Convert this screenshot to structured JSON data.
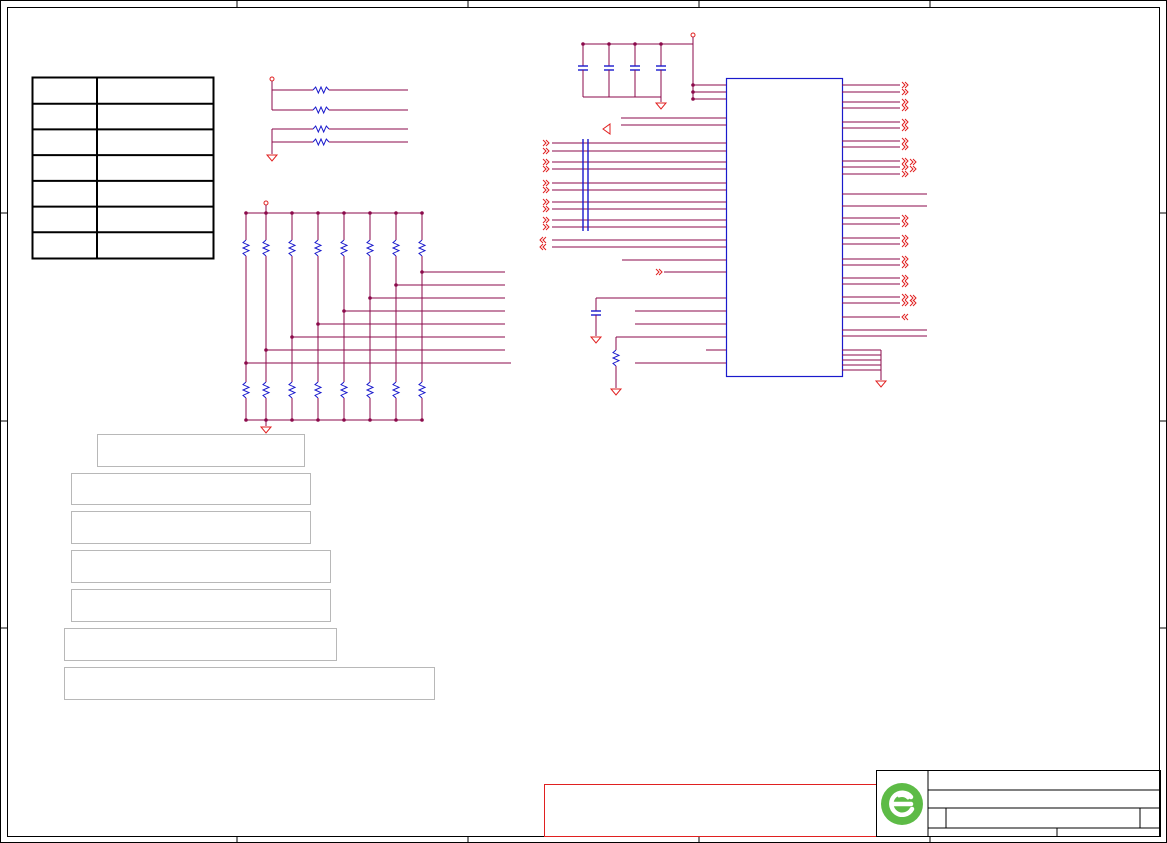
{
  "sheet": {
    "title": "",
    "revision": ""
  },
  "table": {
    "rows": 7,
    "cols": 2
  },
  "notes": [
    {
      "id": "note-1",
      "text": ""
    },
    {
      "id": "note-2",
      "text": ""
    },
    {
      "id": "note-3",
      "text": ""
    },
    {
      "id": "note-4",
      "text": ""
    },
    {
      "id": "note-5",
      "text": ""
    },
    {
      "id": "note-6",
      "text": ""
    },
    {
      "id": "note-7",
      "text": ""
    }
  ],
  "colors": {
    "border": "#000000",
    "wire": "#8b0a4b",
    "net_red": "#e02020",
    "part_blue": "#1a1acc",
    "cap_blue": "#1a1acc",
    "logo_green": "#5dbb46"
  },
  "icons": {
    "logo": "company-logo-icon",
    "ground": "ground-symbol-icon",
    "resistor": "resistor-symbol-icon",
    "capacitor": "capacitor-symbol-icon",
    "off_page": "off-page-connector-icon"
  }
}
